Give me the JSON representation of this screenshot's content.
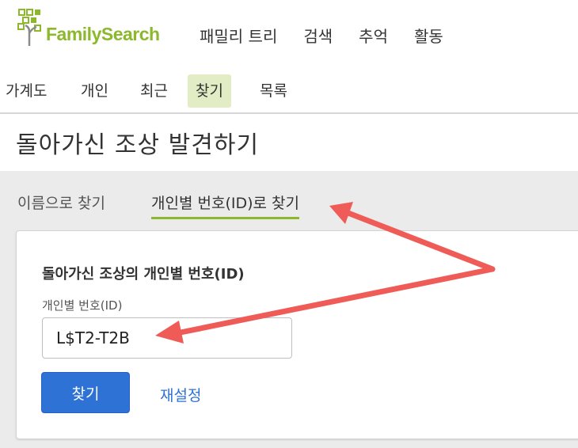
{
  "header": {
    "logo_text": "FamilySearch",
    "nav": [
      "패밀리 트리",
      "검색",
      "추억",
      "활동"
    ]
  },
  "subnav": {
    "tabs": [
      {
        "label": "가계도",
        "active": false
      },
      {
        "label": "개인",
        "active": false
      },
      {
        "label": "최근",
        "active": false
      },
      {
        "label": "찾기",
        "active": true
      },
      {
        "label": "목록",
        "active": false
      }
    ]
  },
  "page": {
    "title": "돌아가신 조상 발견하기"
  },
  "search_methods": {
    "by_name": "이름으로 찾기",
    "by_id": "개인별 번호(ID)로 찾기",
    "active": "by_id"
  },
  "form": {
    "heading": "돌아가신 조상의 개인별 번호(ID)",
    "field_label": "개인별 번호(ID)",
    "field_value": "L$T2-T2B",
    "submit_label": "찾기",
    "reset_label": "재설정"
  },
  "colors": {
    "brand_green": "#8cb82c",
    "active_tab_bg": "#e2edc6",
    "button_blue": "#2f72d6",
    "annotation_arrow": "#ef5b57"
  },
  "icons": [
    "family-tree-logo-icon",
    "annotation-arrow-icon"
  ]
}
